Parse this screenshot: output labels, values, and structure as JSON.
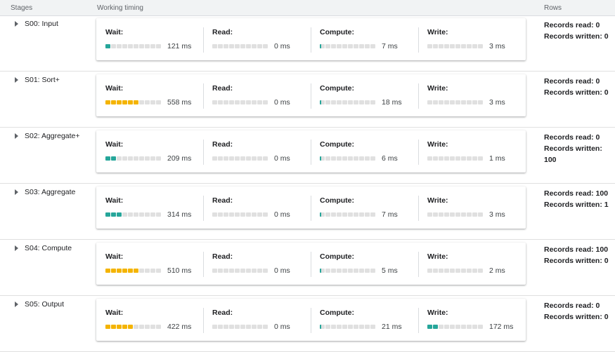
{
  "header": {
    "stages": "Stages",
    "timing": "Working timing",
    "rows": "Rows"
  },
  "colors": {
    "teal": "#26a69a",
    "amber": "#f4b400",
    "empty": "#e0e0e0"
  },
  "icons": {
    "expand": "caret-right-icon"
  },
  "stages": [
    {
      "name": "S00: Input",
      "metrics": [
        {
          "label": "Wait:",
          "value": "121 ms",
          "fill": 0.15,
          "color": "teal"
        },
        {
          "label": "Read:",
          "value": "0 ms",
          "fill": 0.0,
          "color": "teal"
        },
        {
          "label": "Compute:",
          "value": "7 ms",
          "fill": 0.03,
          "color": "teal"
        },
        {
          "label": "Write:",
          "value": "3 ms",
          "fill": 0.0,
          "color": "teal"
        }
      ],
      "records_read": "Records read: 0",
      "records_written": "Records written: 0"
    },
    {
      "name": "S01: Sort+",
      "metrics": [
        {
          "label": "Wait:",
          "value": "558 ms",
          "fill": 0.65,
          "color": "amber"
        },
        {
          "label": "Read:",
          "value": "0 ms",
          "fill": 0.0,
          "color": "teal"
        },
        {
          "label": "Compute:",
          "value": "18 ms",
          "fill": 0.03,
          "color": "teal"
        },
        {
          "label": "Write:",
          "value": "3 ms",
          "fill": 0.0,
          "color": "teal"
        }
      ],
      "records_read": "Records read: 0",
      "records_written": "Records written: 0"
    },
    {
      "name": "S02: Aggregate+",
      "metrics": [
        {
          "label": "Wait:",
          "value": "209 ms",
          "fill": 0.25,
          "color": "teal"
        },
        {
          "label": "Read:",
          "value": "0 ms",
          "fill": 0.0,
          "color": "teal"
        },
        {
          "label": "Compute:",
          "value": "6 ms",
          "fill": 0.03,
          "color": "teal"
        },
        {
          "label": "Write:",
          "value": "1 ms",
          "fill": 0.0,
          "color": "teal"
        }
      ],
      "records_read": "Records read: 0",
      "records_written": "Records written: 100"
    },
    {
      "name": "S03: Aggregate",
      "metrics": [
        {
          "label": "Wait:",
          "value": "314 ms",
          "fill": 0.38,
          "color": "teal"
        },
        {
          "label": "Read:",
          "value": "0 ms",
          "fill": 0.0,
          "color": "teal"
        },
        {
          "label": "Compute:",
          "value": "7 ms",
          "fill": 0.03,
          "color": "teal"
        },
        {
          "label": "Write:",
          "value": "3 ms",
          "fill": 0.0,
          "color": "teal"
        }
      ],
      "records_read": "Records read: 100",
      "records_written": "Records written: 1"
    },
    {
      "name": "S04: Compute",
      "metrics": [
        {
          "label": "Wait:",
          "value": "510 ms",
          "fill": 0.6,
          "color": "amber"
        },
        {
          "label": "Read:",
          "value": "0 ms",
          "fill": 0.0,
          "color": "teal"
        },
        {
          "label": "Compute:",
          "value": "5 ms",
          "fill": 0.03,
          "color": "teal"
        },
        {
          "label": "Write:",
          "value": "2 ms",
          "fill": 0.0,
          "color": "teal"
        }
      ],
      "records_read": "Records read: 100",
      "records_written": "Records written: 0"
    },
    {
      "name": "S05: Output",
      "metrics": [
        {
          "label": "Wait:",
          "value": "422 ms",
          "fill": 0.5,
          "color": "amber"
        },
        {
          "label": "Read:",
          "value": "0 ms",
          "fill": 0.0,
          "color": "teal"
        },
        {
          "label": "Compute:",
          "value": "21 ms",
          "fill": 0.03,
          "color": "teal"
        },
        {
          "label": "Write:",
          "value": "172 ms",
          "fill": 0.2,
          "color": "teal"
        }
      ],
      "records_read": "Records read: 0",
      "records_written": "Records written: 0"
    }
  ]
}
